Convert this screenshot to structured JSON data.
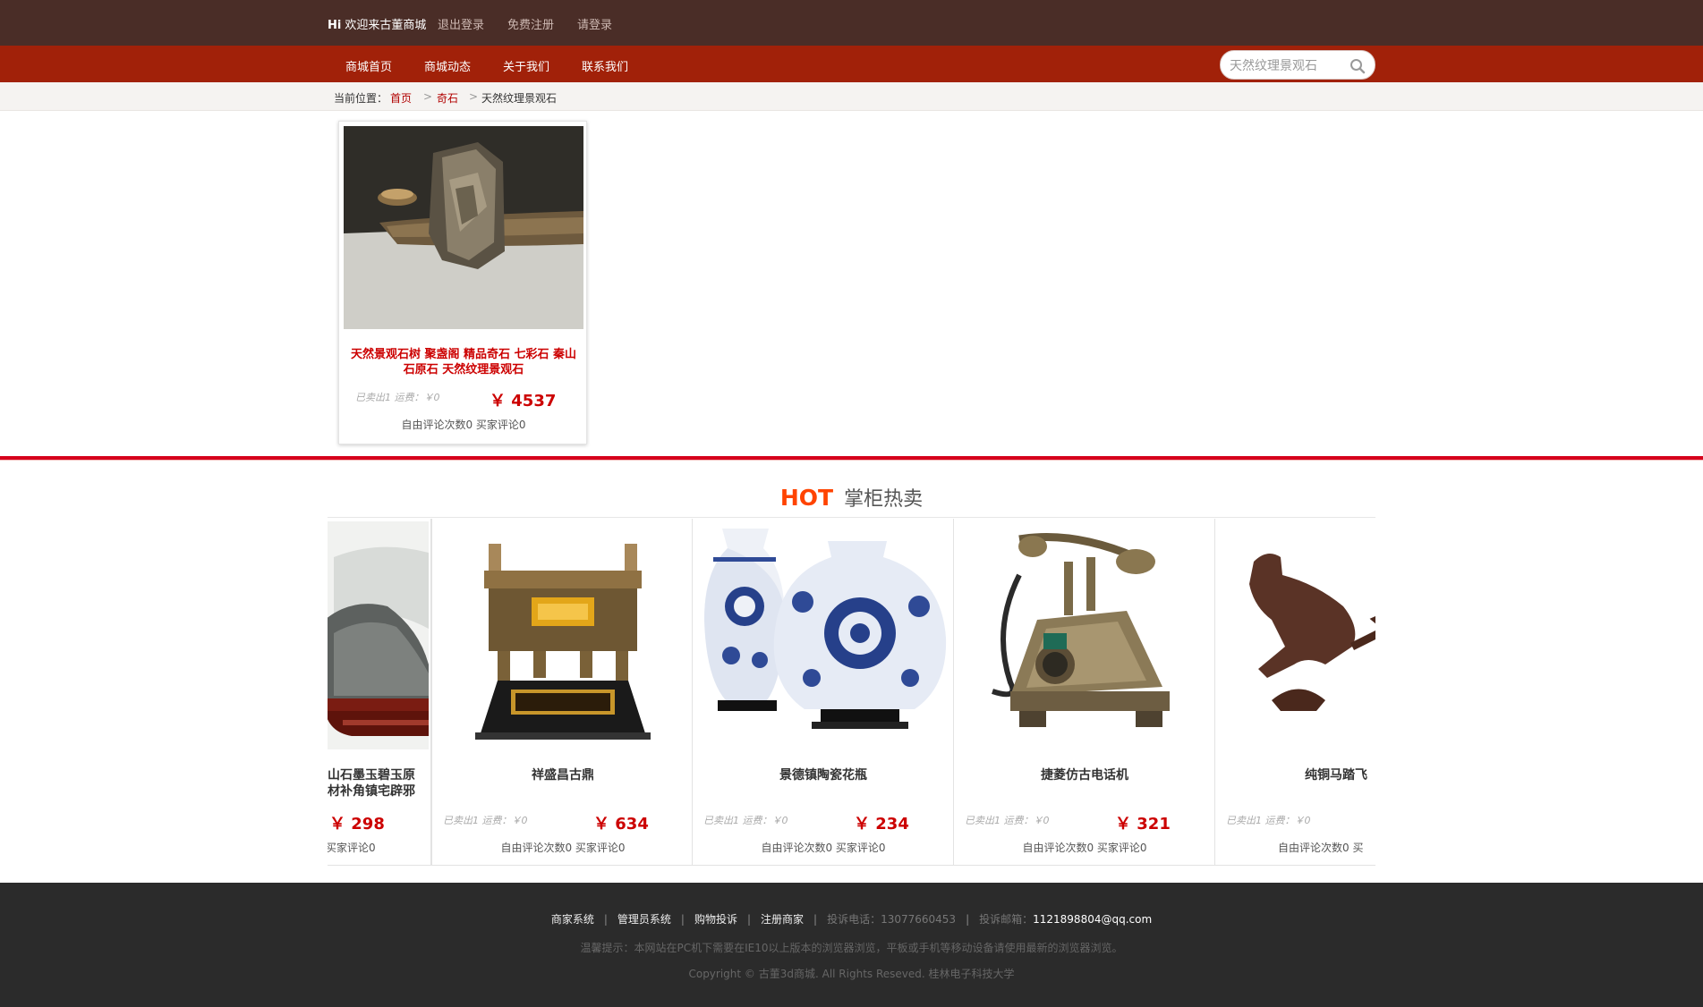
{
  "topbar": {
    "hi": "Hi",
    "welcome": "欢迎来古董商城",
    "logout": "退出登录",
    "register": "免费注册",
    "login": "请登录"
  },
  "nav": {
    "items": [
      "商城首页",
      "商城动态",
      "关于我们",
      "联系我们"
    ],
    "search_value": "天然纹理景观石"
  },
  "breadcrumb": {
    "prefix": "当前位置：",
    "home": "首页",
    "category": "奇石",
    "current": "天然纹理景观石",
    "separator": ">"
  },
  "product": {
    "name": "天然景观石树 聚盏阁 精品奇石 七彩石 秦山石原石 天然纹理景观石",
    "meta": "已卖出1 运费：￥0",
    "price": "￥ 4537",
    "comments": "自由评论次数0   买家评论0"
  },
  "hot": {
    "keyword": "HOT",
    "title": "掌柜热卖",
    "items": [
      {
        "name": "山石墨玉碧玉原\n材补角镇宅辟邪",
        "meta": "",
        "price": "￥ 298",
        "comments": "买家评论0"
      },
      {
        "name": "祥盛昌古鼎",
        "meta": "已卖出1 运费：￥0",
        "price": "￥ 634",
        "comments": "自由评论次数0   买家评论0"
      },
      {
        "name": "景德镇陶瓷花瓶",
        "meta": "已卖出1 运费：￥0",
        "price": "￥ 234",
        "comments": "自由评论次数0   买家评论0"
      },
      {
        "name": "捷菱仿古电话机",
        "meta": "已卖出1 运费：￥0",
        "price": "￥ 321",
        "comments": "自由评论次数0   买家评论0"
      },
      {
        "name": "纯铜马踏飞",
        "meta": "已卖出1 运费：￥0",
        "price": "",
        "comments": "自由评论次数0   买"
      }
    ]
  },
  "footer": {
    "links": [
      "商家系统",
      "管理员系统",
      "购物投诉",
      "注册商家"
    ],
    "phone_label": "投诉电话：13077660453",
    "email_label": "投诉邮箱：",
    "email": "1121898804@qq.com",
    "separator": "|",
    "tip": "温馨提示：本网站在PC机下需要在IE10以上版本的浏览器浏览，平板或手机等移动设备请使用最新的浏览器浏览。",
    "copyright": "Copyright © 古董3d商城. All Rights Reseved. 桂林电子科技大学"
  },
  "colors": {
    "topbar_bg": "#4a2d27",
    "nav_bg": "#a12109",
    "accent_red": "#cc0000",
    "divider_red": "#d6001c",
    "hot_orange": "#ff4400",
    "footer_bg": "#2b2b2b"
  },
  "icons": {
    "search": "search-icon"
  }
}
